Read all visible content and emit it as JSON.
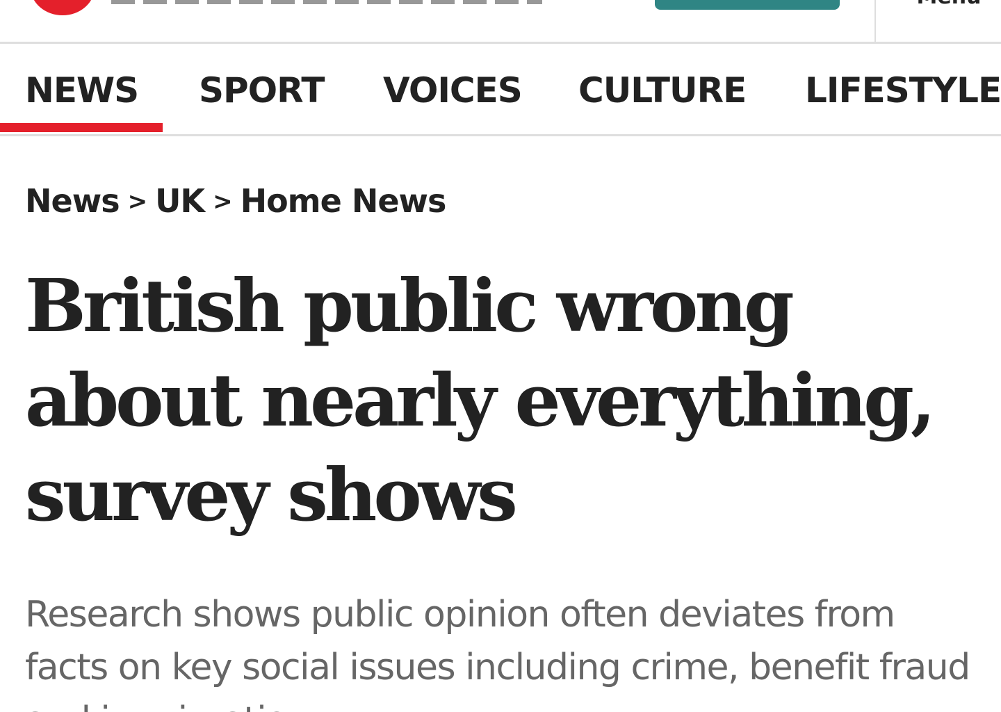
{
  "header": {
    "menu_label": "Menu"
  },
  "nav": {
    "items": [
      {
        "label": "NEWS",
        "active": true
      },
      {
        "label": "SPORT",
        "active": false
      },
      {
        "label": "VOICES",
        "active": false
      },
      {
        "label": "CULTURE",
        "active": false
      },
      {
        "label": "LIFESTYLE",
        "active": false
      }
    ]
  },
  "breadcrumb": {
    "items": [
      "News",
      "UK",
      "Home News"
    ],
    "separator": ">"
  },
  "article": {
    "headline": "British public wrong about nearly everything, survey shows",
    "standfirst": "Research shows public opinion often deviates from facts on key social issues including crime, benefit fraud and immigration"
  },
  "colors": {
    "brand_red": "#e4202b",
    "cta_teal": "#2f8584",
    "text_dark": "#222222",
    "text_grey": "#666666",
    "divider": "#dedede"
  }
}
